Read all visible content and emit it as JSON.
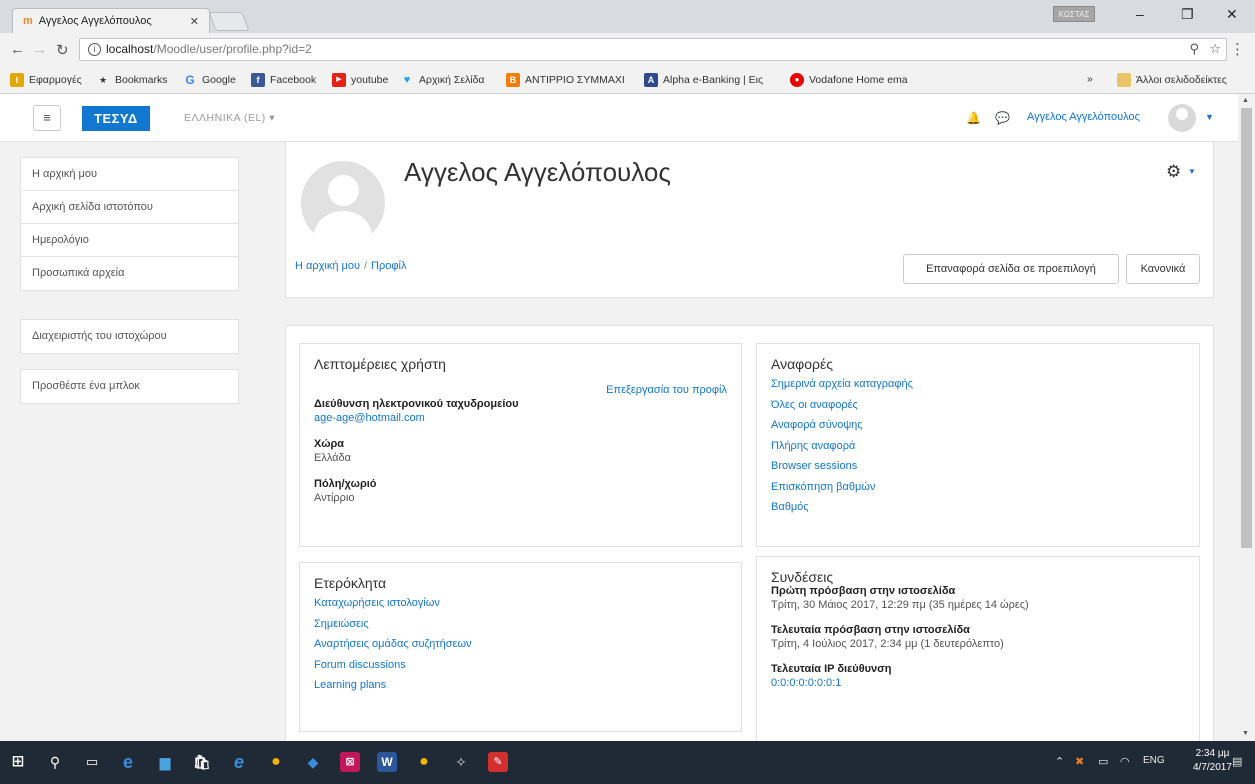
{
  "browser": {
    "tab_title": "Αγγελος Αγγελόπουλος",
    "tab_close": "✕",
    "profile_badge": "ΚΩΣΤΑΣ",
    "url_host": "localhost",
    "url_path": "/Moodle/user/profile.php?id=2"
  },
  "bookmarks": {
    "items": [
      {
        "label": "Εφαρμογές",
        "icon": "apps-icon",
        "color": "#e0a800"
      },
      {
        "label": "Bookmarks",
        "icon": "star-icon",
        "color": "#333333"
      },
      {
        "label": "Google",
        "icon": "google-icon",
        "color": "#4285f4"
      },
      {
        "label": "Facebook",
        "icon": "facebook-icon",
        "color": "#3b5998"
      },
      {
        "label": "youtube",
        "icon": "youtube-icon",
        "color": "#e62117"
      },
      {
        "label": "Αρχική Σελίδα",
        "icon": "twitter-icon",
        "color": "#1da1f2"
      },
      {
        "label": "ΑΝΤΙΡΡΙΟ ΣΥΜΜΑΧΙ",
        "icon": "blogger-icon",
        "color": "#f57d00"
      },
      {
        "label": "Alpha e-Banking | Eις",
        "icon": "bank-icon",
        "color": "#2e4a8c"
      },
      {
        "label": "Vodafone Home ema",
        "icon": "vodafone-icon",
        "color": "#e60000"
      }
    ],
    "more": "»",
    "other_bookmarks": "Άλλοι σελιδοδείκτες"
  },
  "navbar": {
    "brand": "ΤΕΣΥΔ",
    "language": "ΕΛΛΗΝΙΚΑ (EL)",
    "user_name": "Αγγελος Αγγελόπουλος"
  },
  "sidebar": {
    "nav": [
      "Η αρχική μου",
      "Αρχική σελίδα ιστοτόπου",
      "Ημερολόγιο",
      "Προσωπικά αρχεία"
    ],
    "admin": "Διαχειριστής του ιστοχώρου",
    "add_block": "Προσθέστε ένα μπλοκ"
  },
  "header": {
    "fullname": "Αγγελος Αγγελόπουλος",
    "breadcrumb": [
      "Η αρχική μου",
      "Προφίλ"
    ],
    "reset_button": "Επαναφορά σελίδα σε προεπιλογή",
    "normal_button": "Κανονικά"
  },
  "user_details": {
    "title": "Λεπτομέρειες χρήστη",
    "edit_link": "Επεξεργασία του προφίλ",
    "email_label": "Διεύθυνση ηλεκτρονικού ταχυδρομείου",
    "email_value": "age-age@hotmail.com",
    "country_label": "Χώρα",
    "country_value": "Ελλάδα",
    "city_label": "Πόλη/χωριό",
    "city_value": "Αντίρριο"
  },
  "reports": {
    "title": "Αναφορές",
    "links": [
      "Σημερινά αρχεία καταγραφής",
      "Όλες οι αναφορές",
      "Αναφορά σύνοψης",
      "Πλήρης αναφορά",
      "Browser sessions",
      "Επισκόπηση βαθμών",
      "Βαθμός"
    ]
  },
  "misc": {
    "title": "Ετερόκλητα",
    "links": [
      "Καταχωρήσεις ιστολογίων",
      "Σημειώσεις",
      "Αναρτήσεις ομάδας συζητήσεων",
      "Forum discussions",
      "Learning plans"
    ]
  },
  "logins": {
    "title": "Συνδέσεις",
    "first_label": "Πρώτη πρόσβαση στην ιστοσελίδα",
    "first_value": "Τρίτη, 30 Μάιος 2017, 12:29 πμ  (35 ημέρες 14 ώρες)",
    "last_label": "Τελευταία πρόσβαση στην ιστοσελίδα",
    "last_value": "Τρίτη, 4 Ιούλιος 2017, 2:34 μμ  (1 δευτερόλεπτο)",
    "ip_label": "Τελευταία IP διεύθυνση",
    "ip_value": "0:0:0:0:0:0:0:1"
  },
  "taskbar": {
    "lang": "ENG",
    "time": "2:34 μμ",
    "date": "4/7/2017"
  },
  "colors": {
    "accent": "#1177d1",
    "taskbar": "#1f2a36"
  }
}
